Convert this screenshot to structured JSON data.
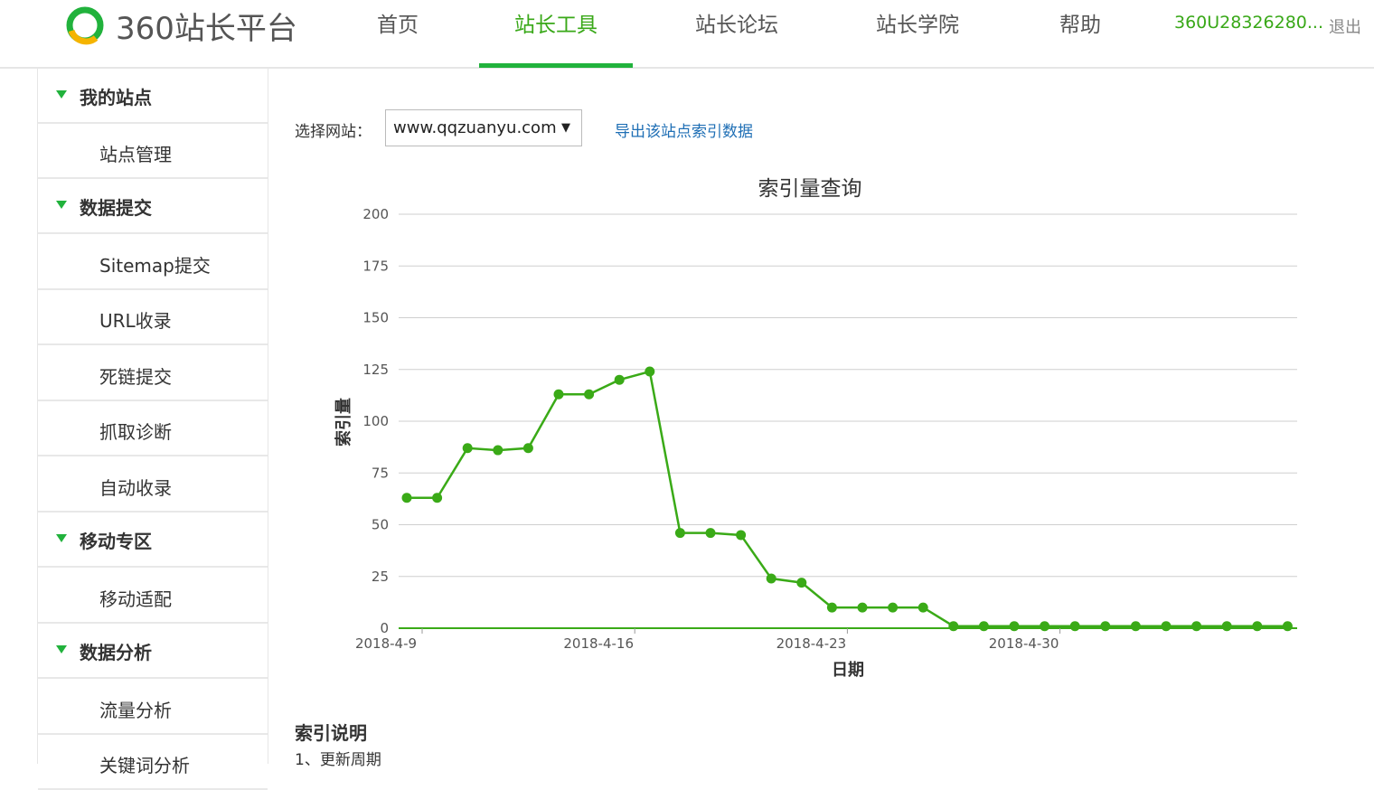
{
  "header": {
    "logo_text": "360站长平台",
    "nav": [
      "首页",
      "站长工具",
      "站长论坛",
      "站长学院",
      "帮助"
    ],
    "active_nav_index": 1,
    "user_name": "360U28326280...",
    "logout": "退出"
  },
  "sidebar": {
    "rows": [
      {
        "type": "group",
        "label": "我的站点"
      },
      {
        "type": "item",
        "label": "站点管理"
      },
      {
        "type": "group",
        "label": "数据提交"
      },
      {
        "type": "item",
        "label": "Sitemap提交"
      },
      {
        "type": "item",
        "label": "URL收录"
      },
      {
        "type": "item",
        "label": "死链提交"
      },
      {
        "type": "item",
        "label": "抓取诊断"
      },
      {
        "type": "item",
        "label": "自动收录"
      },
      {
        "type": "group",
        "label": "移动专区"
      },
      {
        "type": "item",
        "label": "移动适配"
      },
      {
        "type": "group",
        "label": "数据分析"
      },
      {
        "type": "item",
        "label": "流量分析"
      },
      {
        "type": "item",
        "label": "关键词分析"
      }
    ]
  },
  "toolbar": {
    "site_label": "选择网站：",
    "site_value": "www.qqzuanyu.com",
    "caret": "▼",
    "export_link": "导出该站点索引数据"
  },
  "chart_data": {
    "type": "line",
    "title": "索引量查询",
    "xlabel": "日期",
    "ylabel": "索引量",
    "ylim": [
      0,
      200
    ],
    "yticks": [
      0,
      25,
      50,
      75,
      100,
      125,
      150,
      175,
      200
    ],
    "xtick_labels": [
      "2018-4-9",
      "2018-4-16",
      "2018-4-23",
      "2018-4-30"
    ],
    "grid": true,
    "x": [
      "2018-4-9",
      "2018-4-10",
      "2018-4-11",
      "2018-4-12",
      "2018-4-13",
      "2018-4-14",
      "2018-4-15",
      "2018-4-16",
      "2018-4-17",
      "2018-4-18",
      "2018-4-19",
      "2018-4-20",
      "2018-4-21",
      "2018-4-22",
      "2018-4-23",
      "2018-4-24",
      "2018-4-25",
      "2018-4-26",
      "2018-4-27",
      "2018-4-28",
      "2018-4-29",
      "2018-4-30",
      "2018-5-1",
      "2018-5-2",
      "2018-5-3",
      "2018-5-4",
      "2018-5-5",
      "2018-5-6",
      "2018-5-7",
      "2018-5-8"
    ],
    "series": [
      {
        "values": [
          63,
          63,
          87,
          86,
          87,
          113,
          113,
          120,
          124,
          46,
          46,
          45,
          24,
          22,
          10,
          10,
          10,
          10,
          1,
          1,
          1,
          1,
          1,
          1,
          1,
          1,
          1,
          1,
          1,
          1
        ],
        "color": "#3aaa17"
      }
    ]
  },
  "description": {
    "title": "索引说明",
    "items": [
      "1、更新周期"
    ]
  }
}
